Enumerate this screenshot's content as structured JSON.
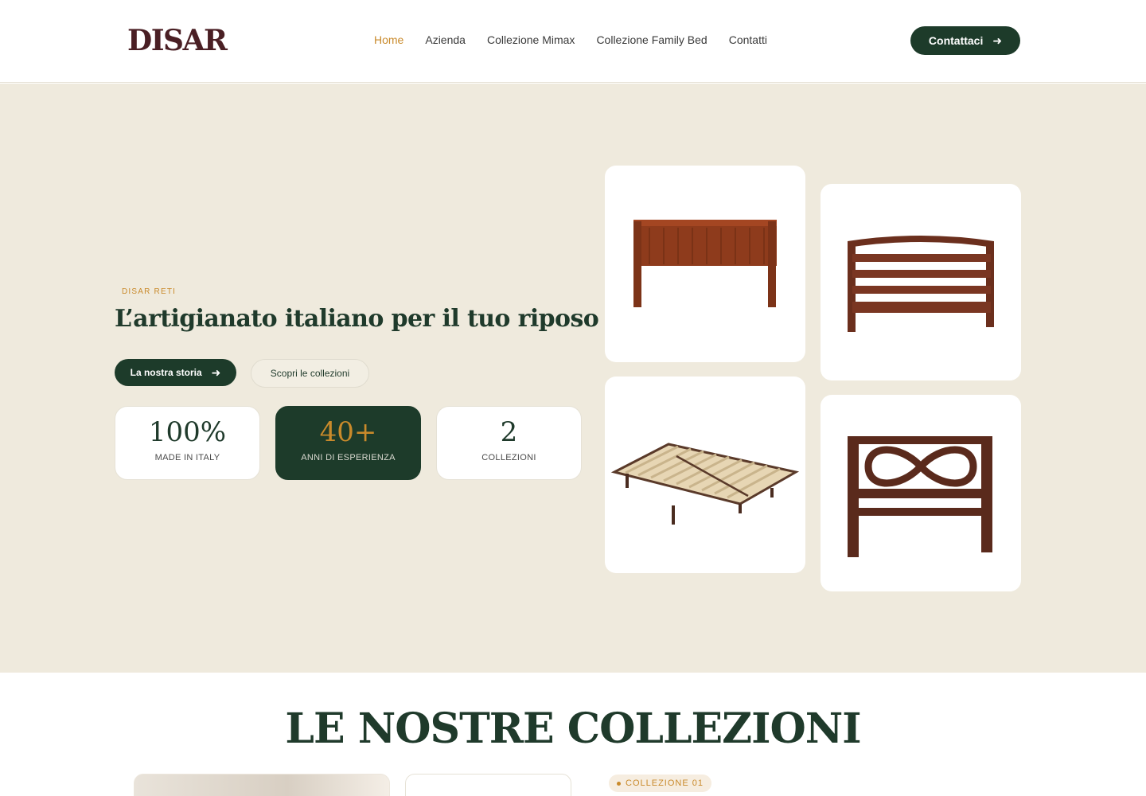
{
  "header": {
    "logo": "DISAR",
    "nav": [
      "Home",
      "Azienda",
      "Collezione Mimax",
      "Collezione Family Bed",
      "Contatti"
    ],
    "active_nav": "Home",
    "contact_button": "Contattaci"
  },
  "hero": {
    "eyebrow": "DISAR RETI",
    "title": "L’artigianato italiano per il tuo riposo",
    "primary_button": "La nostra storia",
    "secondary_button": "Scopri le collezioni",
    "stats": [
      {
        "value": "100%",
        "label": "MADE IN ITALY"
      },
      {
        "value": "40+",
        "label": "ANNI DI ESPERIENZA"
      },
      {
        "value": "2",
        "label": "COLLEZIONI"
      }
    ]
  },
  "collections": {
    "title": "LE NOSTRE COLLEZIONI",
    "badge": "COLLEZIONE 01"
  },
  "colors": {
    "brand_green": "#1d3b2a",
    "accent_gold": "#c98a2b",
    "hero_bg": "#efeadd",
    "logo": "#4a1f24"
  }
}
